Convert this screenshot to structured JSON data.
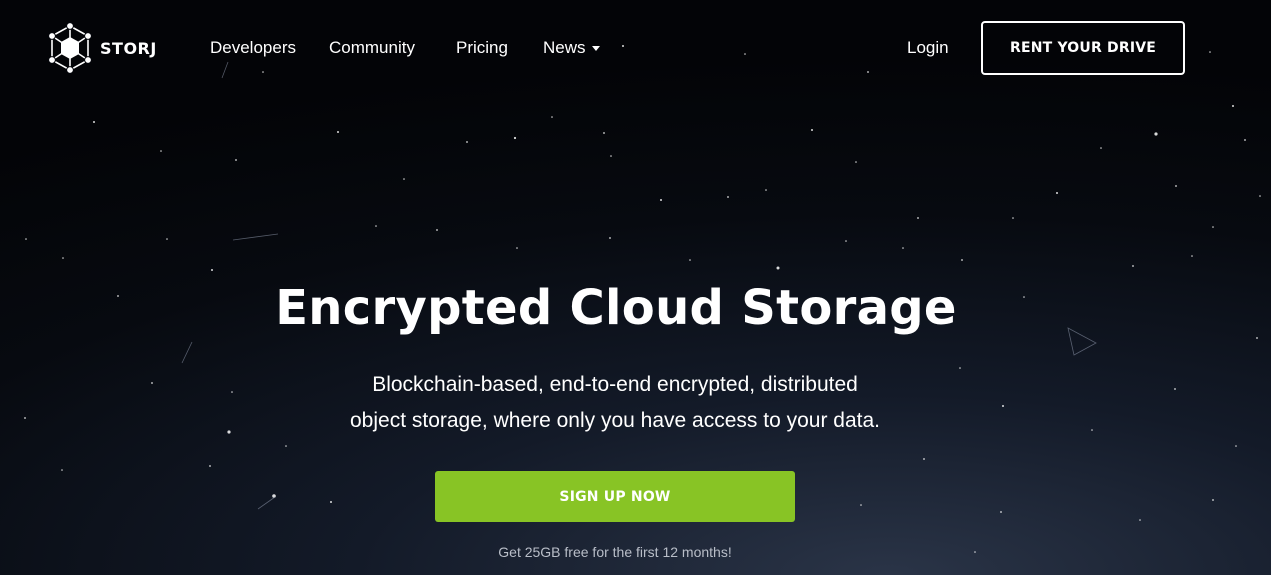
{
  "brand": {
    "name": "STORJ",
    "logo_icon": "storj-network-hex-logo"
  },
  "nav": {
    "links": [
      {
        "label": "Developers"
      },
      {
        "label": "Community"
      },
      {
        "label": "Pricing"
      },
      {
        "label": "News",
        "has_dropdown": true
      }
    ],
    "login_label": "Login",
    "cta_label": "RENT YOUR DRIVE"
  },
  "hero": {
    "title": "Encrypted Cloud Storage",
    "subtitle_line1": "Blockchain-based, end-to-end encrypted, distributed",
    "subtitle_line2": "object storage, where only you have access to your data.",
    "button_label": "SIGN UP NOW",
    "note": "Get 25GB free for the first 12 months!"
  },
  "colors": {
    "accent_green": "#88c425",
    "background_dark": "#05070c",
    "text_white": "#ffffff"
  }
}
